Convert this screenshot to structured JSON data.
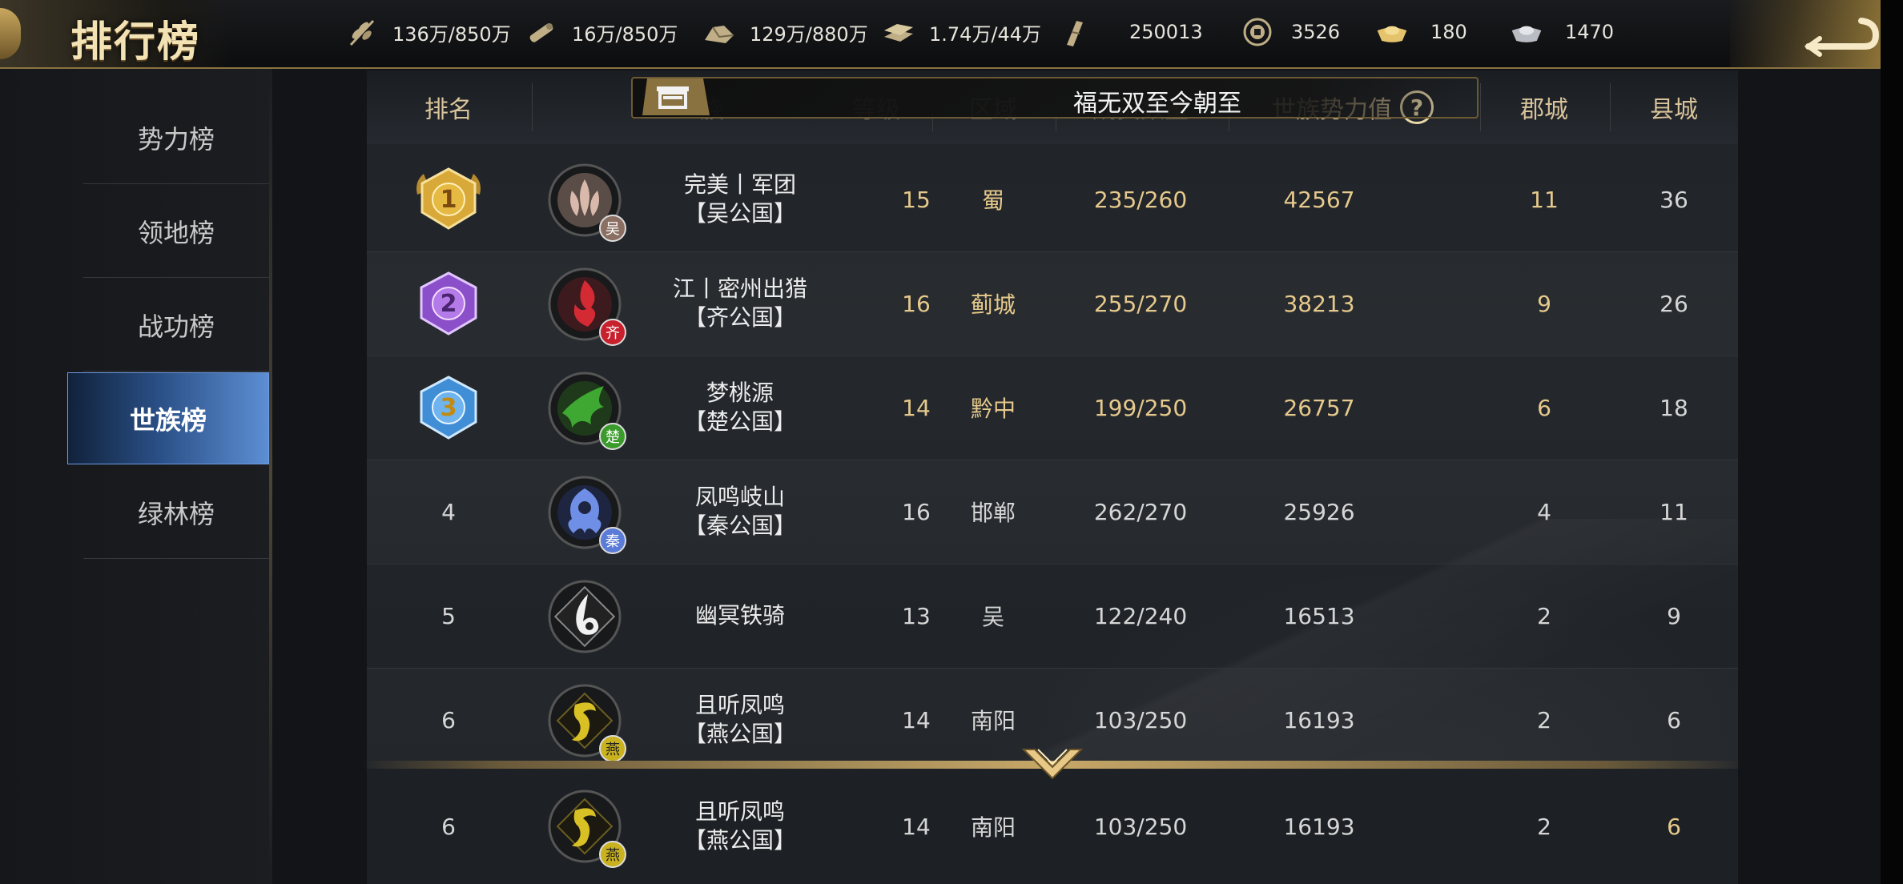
{
  "header": {
    "title": "排行榜",
    "resources": [
      {
        "icon": "grain-icon",
        "value": "136万/850万"
      },
      {
        "icon": "wood-icon",
        "value": "16万/850万"
      },
      {
        "icon": "stone-icon",
        "value": "129万/880万"
      },
      {
        "icon": "iron-icon",
        "value": "1.74万/44万"
      },
      {
        "icon": "decree-icon",
        "value": "250013"
      },
      {
        "icon": "copper-coin-icon",
        "value": "3526"
      },
      {
        "icon": "gold-ingot-icon",
        "value": "180"
      },
      {
        "icon": "silver-ingot-icon",
        "value": "1470"
      }
    ]
  },
  "sidebar": {
    "items": [
      {
        "label": "势力榜"
      },
      {
        "label": "领地榜"
      },
      {
        "label": "战功榜"
      },
      {
        "label": "世族榜",
        "active": true
      },
      {
        "label": "绿林榜"
      }
    ]
  },
  "notice": {
    "text": "福无双至今朝至"
  },
  "table": {
    "headers": {
      "rank": "排名",
      "clan": "世族",
      "level": "等级",
      "region": "区域",
      "members": "成员数量",
      "power": "世族势力值",
      "prefecture": "郡城",
      "county": "县城"
    },
    "rows": [
      {
        "rank": "1",
        "name": "完美丨军团",
        "state": "【吴公国】",
        "badge": "吴",
        "level": "15",
        "region": "蜀",
        "members": "235/260",
        "power": "42567",
        "prefecture": "11",
        "county": "36"
      },
      {
        "rank": "2",
        "name": "江丨密州出猎",
        "state": "【齐公国】",
        "badge": "齐",
        "level": "16",
        "region": "蓟城",
        "members": "255/270",
        "power": "38213",
        "prefecture": "9",
        "county": "26"
      },
      {
        "rank": "3",
        "name": "梦桃源",
        "state": "【楚公国】",
        "badge": "楚",
        "level": "14",
        "region": "黔中",
        "members": "199/250",
        "power": "26757",
        "prefecture": "6",
        "county": "18"
      },
      {
        "rank": "4",
        "name": "凤鸣岐山",
        "state": "【秦公国】",
        "badge": "秦",
        "level": "16",
        "region": "邯郸",
        "members": "262/270",
        "power": "25926",
        "prefecture": "4",
        "county": "11"
      },
      {
        "rank": "5",
        "name": "幽冥铁骑",
        "state": "",
        "badge": "",
        "level": "13",
        "region": "吴",
        "members": "122/240",
        "power": "16513",
        "prefecture": "2",
        "county": "9"
      },
      {
        "rank": "6",
        "name": "且听凤鸣",
        "state": "【燕公国】",
        "badge": "燕",
        "level": "14",
        "region": "南阳",
        "members": "103/250",
        "power": "16193",
        "prefecture": "2",
        "county": "6"
      }
    ],
    "my_row": {
      "rank": "6",
      "name": "且听凤鸣",
      "state": "【燕公国】",
      "badge": "燕",
      "level": "14",
      "region": "南阳",
      "members": "103/250",
      "power": "16193",
      "prefecture": "2",
      "county": "6"
    }
  },
  "colors": {
    "gold_text": "#e6c98c",
    "active_tab": "#3f6fb5",
    "badge_wu": "#8a6f62",
    "badge_qi": "#c8202c",
    "badge_chu": "#3b9a2c",
    "badge_qin": "#5b7bd8",
    "badge_yan": "#c9b21e"
  }
}
